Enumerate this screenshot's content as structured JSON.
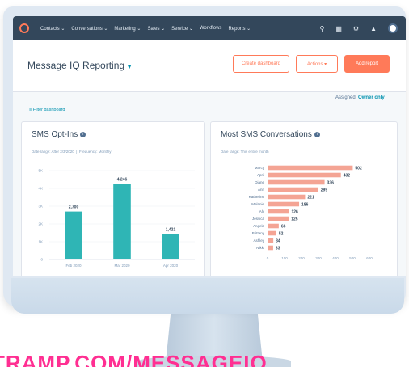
{
  "navbar": {
    "items": [
      "Contacts ⌄",
      "Conversations ⌄",
      "Marketing ⌄",
      "Sales ⌄",
      "Service ⌄",
      "Workflows",
      "Reports ⌄"
    ],
    "icons": [
      "search-icon",
      "marketplace-icon",
      "settings-icon",
      "notifications-icon"
    ]
  },
  "header": {
    "title": "Message IQ Reporting",
    "create_dashboard": "Create dashboard",
    "actions": "Actions ▾",
    "add_report": "Add report"
  },
  "toolbar": {
    "filter": "Filter dashboard",
    "assigned_label": "Assigned:",
    "assigned_value": "Owner only"
  },
  "left_card": {
    "title": "SMS Opt-Ins",
    "date_range": "Date range: After 2/3/2020",
    "frequency": "Frequency: Monthly"
  },
  "right_card": {
    "title": "Most SMS Conversations",
    "date_range": "Date range: This entire month"
  },
  "chart_data": [
    {
      "type": "bar",
      "title": "SMS Opt-Ins",
      "categories": [
        "Feb 2020",
        "Mar 2020",
        "Apr 2020"
      ],
      "values": [
        2700,
        4246,
        1421
      ],
      "value_labels": [
        "2,700",
        "4,246",
        "1,421"
      ],
      "ylim": [
        0,
        5000
      ],
      "yticks": [
        "0",
        "1K",
        "2K",
        "3K",
        "4K",
        "5K"
      ],
      "color": "#2fb5b5"
    },
    {
      "type": "bar",
      "orientation": "horizontal",
      "title": "Most SMS Conversations",
      "categories": [
        "Marcy",
        "April",
        "Diane",
        "Ann",
        "Katherine",
        "Melanie",
        "Aly",
        "Jessica",
        "Angela",
        "Brittany",
        "Ashley",
        "Nikki"
      ],
      "values": [
        502,
        432,
        336,
        299,
        221,
        186,
        126,
        125,
        66,
        52,
        34,
        33
      ],
      "xlim": [
        0,
        600
      ],
      "xticks": [
        "0",
        "100",
        "200",
        "300",
        "400",
        "500",
        "600"
      ],
      "color": "#f4a494"
    }
  ],
  "watermark": "TRAMP.COM/MESSAGEIQ"
}
